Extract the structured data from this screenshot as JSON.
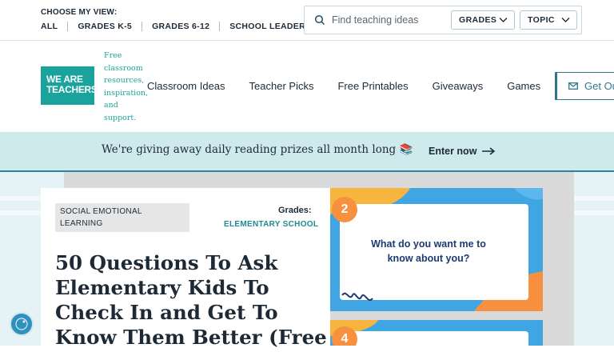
{
  "topbar": {
    "choose_label": "CHOOSE MY VIEW:",
    "views": [
      "ALL",
      "GRADES K-5",
      "GRADES 6-12",
      "SCHOOL LEADERS"
    ],
    "search_placeholder": "Find teaching ideas",
    "grades_dropdown": "GRADES",
    "topic_dropdown": "TOPIC"
  },
  "nav": {
    "logo_line1": "WE ARE",
    "logo_line2": "TEACHERS",
    "tagline": "Free classroom resources, inspiration, and support.",
    "items": [
      "Classroom Ideas",
      "Teacher Picks",
      "Free Printables",
      "Giveaways",
      "Games"
    ],
    "cta": "Get Ou"
  },
  "banner": {
    "text": "We're giving away daily reading prizes all month long 📚",
    "cta": "Enter now"
  },
  "article": {
    "category": "SOCIAL EMOTIONAL LEARNING",
    "grades_label": "Grades:",
    "grades_value": "ELEMENTARY SCHOOL",
    "title": "50 Questions To Ask Elementary Kids To Check In and Get To Know Them Better (Free"
  },
  "image": {
    "card1_number": "2",
    "card1_text": "What do you want me to know about you?",
    "card2_number": "4"
  },
  "colors": {
    "teal": "#1aa39d",
    "banner_bg": "#cfeaed",
    "slide_blue": "#3fa6e3",
    "slide_orange": "#f7913f"
  }
}
